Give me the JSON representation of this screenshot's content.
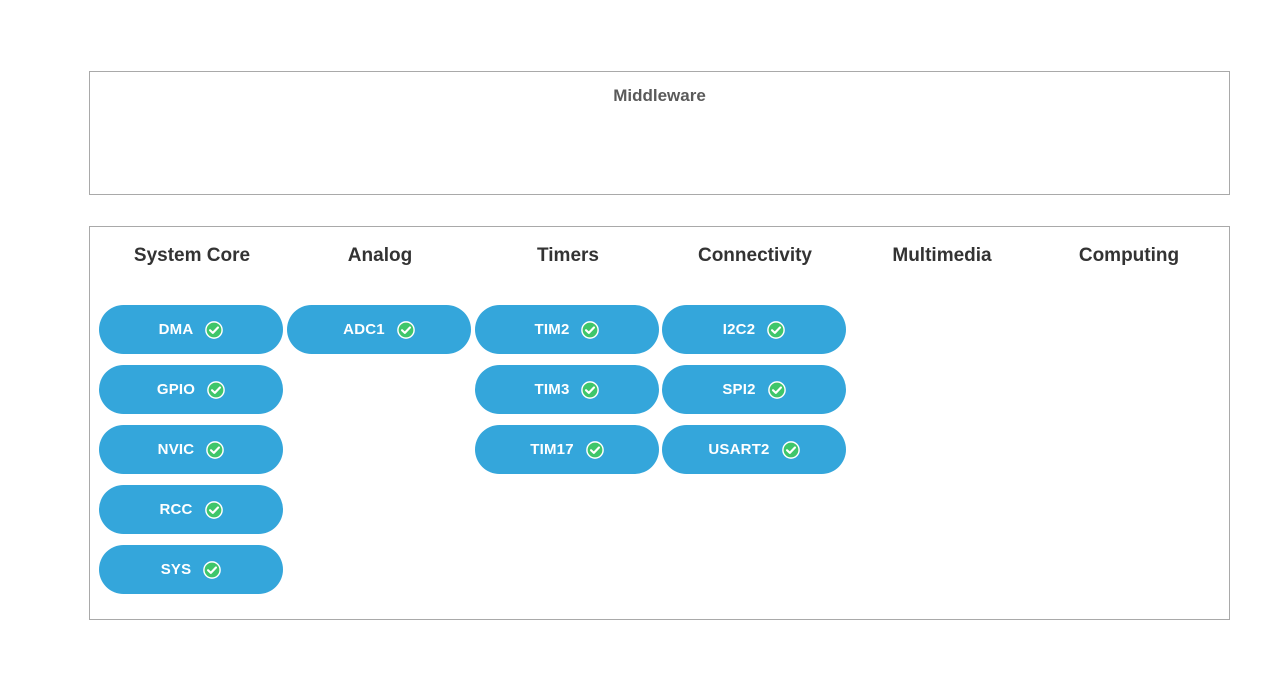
{
  "middleware": {
    "title": "Middleware"
  },
  "colors": {
    "pill": "#34a6db",
    "check_circle": "#3fc66a",
    "border": "#a9a9a9"
  },
  "categories": [
    {
      "header": "System Core",
      "items": [
        {
          "label": "DMA",
          "status": "check-circle-icon"
        },
        {
          "label": "GPIO",
          "status": "check-circle-icon"
        },
        {
          "label": "NVIC",
          "status": "check-circle-icon"
        },
        {
          "label": "RCC",
          "status": "check-circle-icon"
        },
        {
          "label": "SYS",
          "status": "check-circle-icon"
        }
      ]
    },
    {
      "header": "Analog",
      "items": [
        {
          "label": "ADC1",
          "status": "check-circle-icon"
        }
      ]
    },
    {
      "header": "Timers",
      "items": [
        {
          "label": "TIM2",
          "status": "check-circle-icon"
        },
        {
          "label": "TIM3",
          "status": "check-circle-icon"
        },
        {
          "label": "TIM17",
          "status": "check-circle-icon"
        }
      ]
    },
    {
      "header": "Connectivity",
      "items": [
        {
          "label": "I2C2",
          "status": "check-circle-icon"
        },
        {
          "label": "SPI2",
          "status": "check-circle-icon"
        },
        {
          "label": "USART2",
          "status": "check-circle-icon"
        }
      ]
    },
    {
      "header": "Multimedia",
      "items": []
    },
    {
      "header": "Computing",
      "items": []
    }
  ]
}
